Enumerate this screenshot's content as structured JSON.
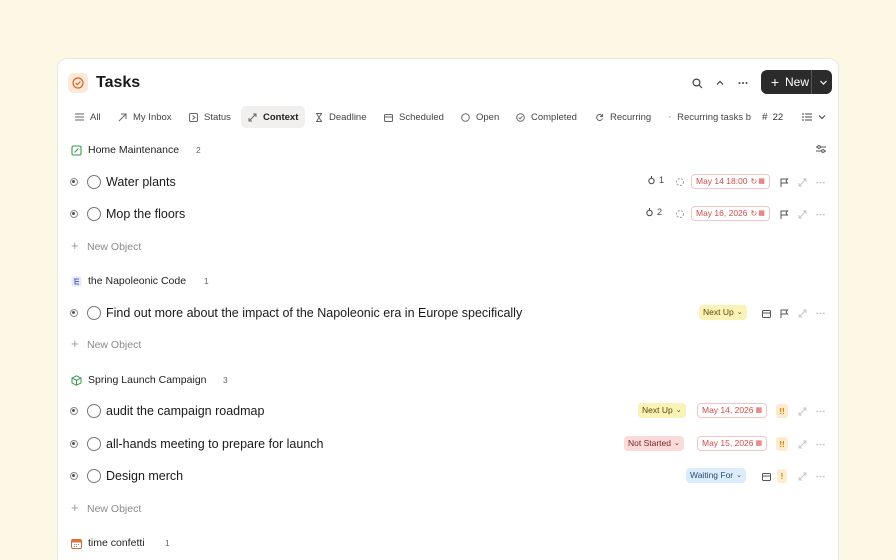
{
  "header": {
    "title": "Tasks",
    "new_label": "New"
  },
  "tabs": [
    {
      "label": "All"
    },
    {
      "label": "My Inbox"
    },
    {
      "label": "Status"
    },
    {
      "label": "Context"
    },
    {
      "label": "Deadline"
    },
    {
      "label": "Scheduled"
    },
    {
      "label": "Open"
    },
    {
      "label": "Completed"
    },
    {
      "label": "Recurring"
    },
    {
      "label": "Recurring tasks b"
    }
  ],
  "tabs_extra": {
    "count": "22"
  },
  "groups": [
    {
      "name": "Home Maintenance",
      "count": "2",
      "tasks": [
        {
          "name": "Water plants",
          "subtasks": "1",
          "date": "May 14 18:00"
        },
        {
          "name": "Mop the floors",
          "subtasks": "2",
          "date": "May 16, 2026"
        }
      ],
      "new_object": "New Object"
    },
    {
      "name": "the Napoleonic Code",
      "count": "1",
      "tasks": [
        {
          "name": "Find out more about the impact of the Napoleonic era in Europe specifically",
          "status": "Next Up"
        }
      ],
      "new_object": "New Object"
    },
    {
      "name": "Spring Launch Campaign",
      "count": "3",
      "tasks": [
        {
          "name": "audit the campaign roadmap",
          "status": "Next Up",
          "date": "May 14, 2026",
          "priority": "!!"
        },
        {
          "name": "all-hands meeting to prepare for launch",
          "status": "Not Started",
          "date": "May 15, 2026",
          "priority": "!!"
        },
        {
          "name": "Design merch",
          "status": "Waiting For",
          "priority": "!"
        }
      ],
      "new_object": "New Object"
    },
    {
      "name": "time confetti",
      "count": "1"
    }
  ],
  "colors": {
    "background": "#fdf8e6",
    "accent_dark": "#2b2b2b",
    "date_red": "#d44b4b"
  },
  "icons": [
    "check-circle-icon",
    "search-icon",
    "chevron-up-icon",
    "more-icon",
    "plus-icon",
    "chevron-down-icon",
    "filter-icon",
    "flag-icon",
    "calendar-icon",
    "expand-icon"
  ]
}
